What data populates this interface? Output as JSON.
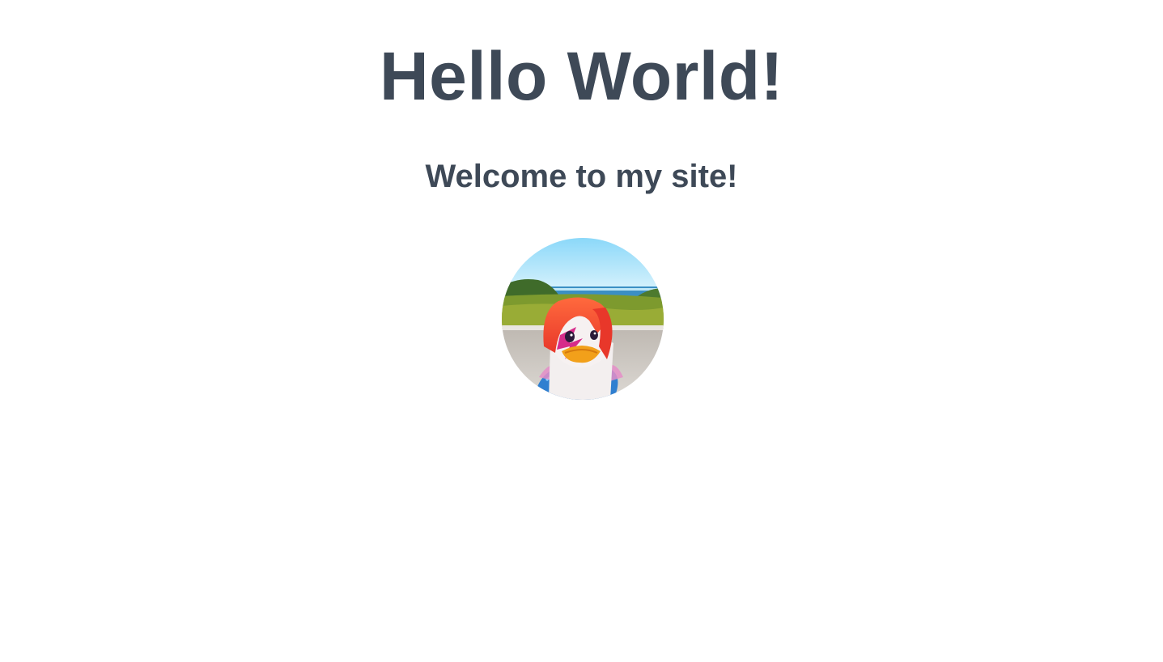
{
  "page": {
    "title": "Hello World!",
    "subtitle": "Welcome to my site!"
  },
  "avatar": {
    "subject": "rubber duck with red hair and lightning-bolt face paint on a beach",
    "colors": {
      "sky": "#9fe3fb",
      "sea": "#3b8fc4",
      "grass": "#6f8f2c",
      "sand": "#cfcac4",
      "hair": "#f24a2f",
      "beak": "#f29a1a",
      "jacket": "#2f7fd0"
    }
  },
  "theme": {
    "text_color": "#3e4957",
    "background": "#ffffff"
  }
}
